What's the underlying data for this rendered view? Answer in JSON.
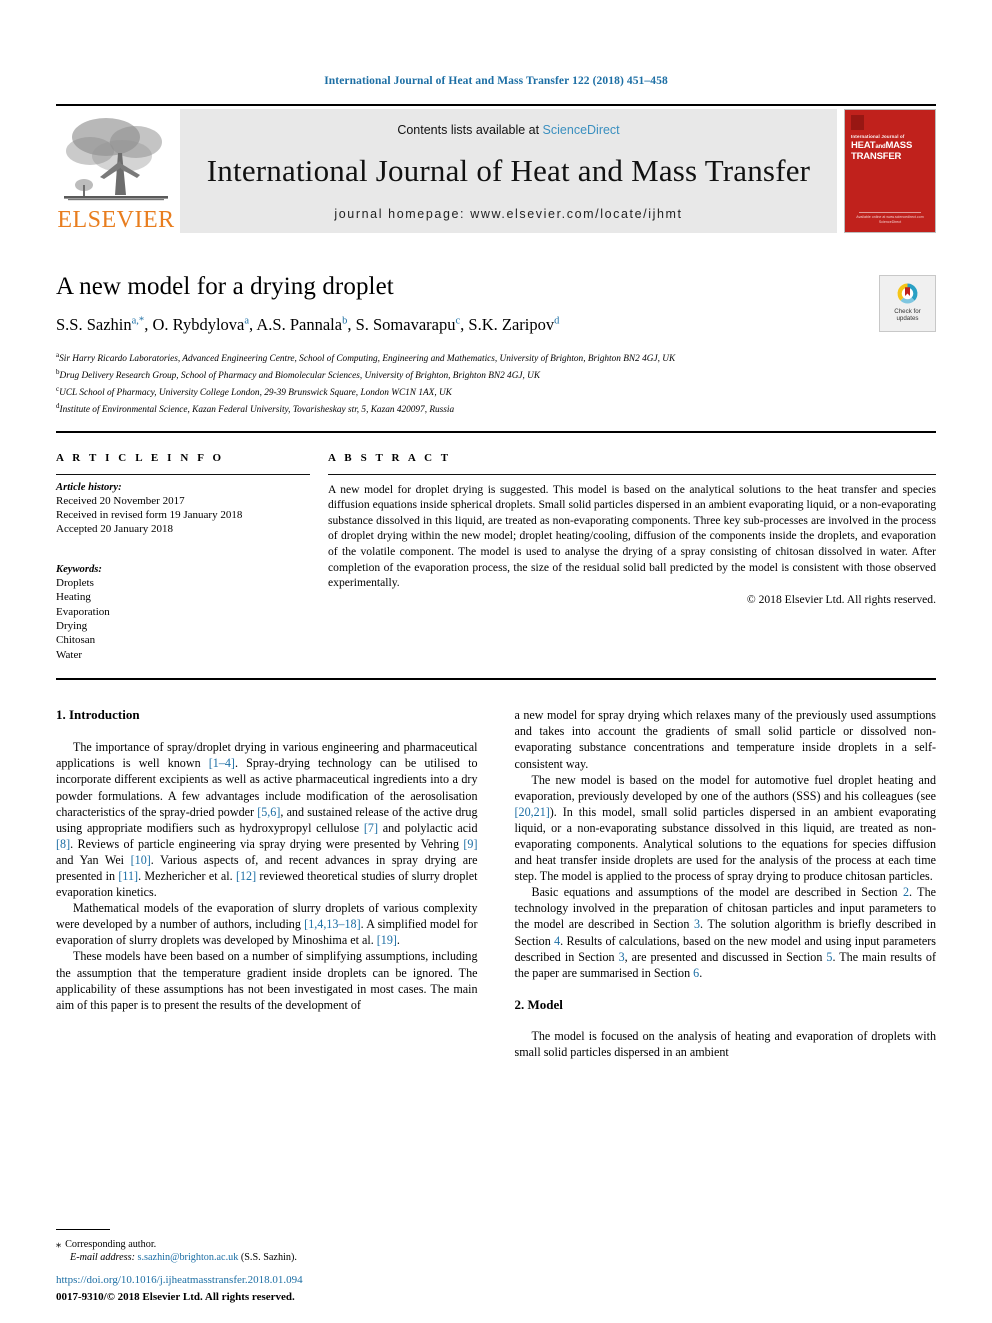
{
  "running_head": "International Journal of Heat and Mass Transfer 122 (2018) 451–458",
  "masthead": {
    "publisher_logo_text": "ELSEVIER",
    "contents_prefix": "Contents lists available at ",
    "contents_link": "ScienceDirect",
    "journal_title": "International Journal of Heat and Mass Transfer",
    "journal_homepage": "journal homepage: www.elsevier.com/locate/ijhmt",
    "cover": {
      "superline": "International Journal of",
      "line1": "HEAT",
      "line1b": "and",
      "line1c": "MASS",
      "line2": "TRANSFER",
      "footer1": "Available online at www.sciencedirect.com",
      "footer2": "ScienceDirect"
    }
  },
  "article": {
    "title": "A new model for a drying droplet",
    "authors": [
      {
        "name": "S.S. Sazhin",
        "marks": "a,*"
      },
      {
        "name": "O. Rybdylova",
        "marks": "a"
      },
      {
        "name": "A.S. Pannala",
        "marks": "b"
      },
      {
        "name": "S. Somavarapu",
        "marks": "c"
      },
      {
        "name": "S.K. Zaripov",
        "marks": "d"
      }
    ],
    "affiliations": [
      {
        "mark": "a",
        "text": "Sir Harry Ricardo Laboratories, Advanced Engineering Centre, School of Computing, Engineering and Mathematics, University of Brighton, Brighton BN2 4GJ, UK"
      },
      {
        "mark": "b",
        "text": "Drug Delivery Research Group, School of Pharmacy and Biomolecular Sciences, University of Brighton, Brighton BN2 4GJ, UK"
      },
      {
        "mark": "c",
        "text": "UCL School of Pharmacy, University College London, 29-39 Brunswick Square, London WC1N 1AX, UK"
      },
      {
        "mark": "d",
        "text": "Institute of Environmental Science, Kazan Federal University, Tovarisheskay str, 5, Kazan 420097, Russia"
      }
    ],
    "crossmark": {
      "line1": "Check for",
      "line2": "updates"
    }
  },
  "article_info": {
    "section_label": "A R T I C L E   I N F O",
    "history_label": "Article history:",
    "history": [
      "Received 20 November 2017",
      "Received in revised form 19 January 2018",
      "Accepted 20 January 2018"
    ],
    "keywords_label": "Keywords:",
    "keywords": [
      "Droplets",
      "Heating",
      "Evaporation",
      "Drying",
      "Chitosan",
      "Water"
    ]
  },
  "abstract": {
    "section_label": "A B S T R A C T",
    "text": "A new model for droplet drying is suggested. This model is based on the analytical solutions to the heat transfer and species diffusion equations inside spherical droplets. Small solid particles dispersed in an ambient evaporating liquid, or a non-evaporating substance dissolved in this liquid, are treated as non-evaporating components. Three key sub-processes are involved in the process of droplet drying within the new model; droplet heating/cooling, diffusion of the components inside the droplets, and evaporation of the volatile component. The model is used to analyse the drying of a spray consisting of chitosan dissolved in water. After completion of the evaporation process, the size of the residual solid ball predicted by the model is consistent with those observed experimentally.",
    "copyright": "© 2018 Elsevier Ltd. All rights reserved."
  },
  "sections": {
    "intro_heading": "1. Introduction",
    "intro_p1": "The importance of spray/droplet drying in various engineering and pharmaceutical applications is well known [1–4]. Spray-drying technology can be utilised to incorporate different excipients as well as active pharmaceutical ingredients into a dry powder formulations. A few advantages include modification of the aerosolisation characteristics of the spray-dried powder [5,6], and sustained release of the active drug using appropriate modifiers such as hydroxypropyl cellulose [7] and polylactic acid [8]. Reviews of particle engineering via spray drying were presented by Vehring [9] and Yan Wei [10]. Various aspects of, and recent advances in spray drying are presented in [11]. Mezhericher et al. [12] reviewed theoretical studies of slurry droplet evaporation kinetics.",
    "intro_p2": "Mathematical models of the evaporation of slurry droplets of various complexity were developed by a number of authors, including [1,4,13–18]. A simplified model for evaporation of slurry droplets was developed by Minoshima et al. [19].",
    "intro_p3": "These models have been based on a number of simplifying assumptions, including the assumption that the temperature gradient inside droplets can be ignored. The applicability of these assumptions has not been investigated in most cases. The main aim of this paper is to present the results of the development of",
    "intro_p4": "a new model for spray drying which relaxes many of the previously used assumptions and takes into account the gradients of small solid particle or dissolved non-evaporating substance concentrations and temperature inside droplets in a self-consistent way.",
    "intro_p5": "The new model is based on the model for automotive fuel droplet heating and evaporation, previously developed by one of the authors (SSS) and his colleagues (see [20,21]). In this model, small solid particles dispersed in an ambient evaporating liquid, or a non-evaporating substance dissolved in this liquid, are treated as non-evaporating components. Analytical solutions to the equations for species diffusion and heat transfer inside droplets are used for the analysis of the process at each time step. The model is applied to the process of spray drying to produce chitosan particles.",
    "intro_p6": "Basic equations and assumptions of the model are described in Section 2. The technology involved in the preparation of chitosan particles and input parameters to the model are described in Section 3. The solution algorithm is briefly described in Section 4. Results of calculations, based on the new model and using input parameters described in Section 3, are presented and discussed in Section 5. The main results of the paper are summarised in Section 6.",
    "model_heading": "2. Model",
    "model_p1": "The model is focused on the analysis of heating and evaporation of droplets with small solid particles dispersed in an ambient"
  },
  "footer": {
    "corresponding_marker": "⁎",
    "corresponding_label": "Corresponding author.",
    "email_label": "E-mail address:",
    "email": "s.sazhin@brighton.ac.uk",
    "email_owner": "(S.S. Sazhin).",
    "doi": "https://doi.org/10.1016/j.ijheatmasstransfer.2018.01.094",
    "issn": "0017-9310/© 2018 Elsevier Ltd. All rights reserved."
  },
  "colors": {
    "link": "#1c6ea4",
    "elsevier_orange": "#E87D1E",
    "cover_red": "#c0211c",
    "band_gray": "#e8e8e8"
  }
}
